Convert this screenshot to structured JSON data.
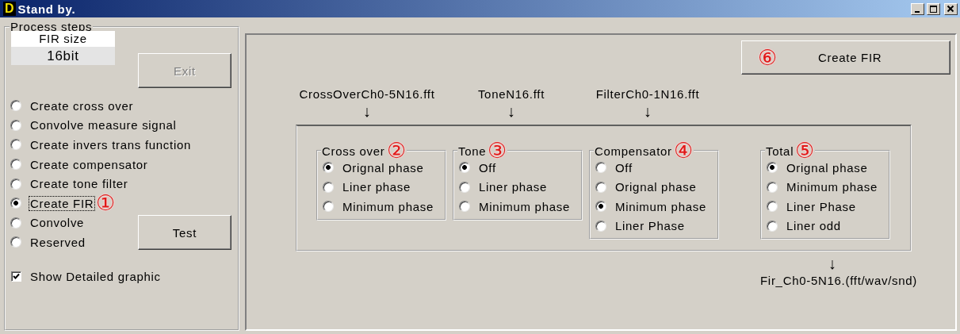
{
  "window": {
    "title": "Stand by.",
    "logo_letter": "D"
  },
  "process_steps": {
    "title": "Process steps",
    "fir_size": {
      "label": "FIR size",
      "value": "16bit"
    },
    "exit_button": {
      "label": "Exit",
      "disabled": true
    },
    "steps": [
      {
        "label": "Create cross over",
        "selected": false
      },
      {
        "label": "Convolve measure signal",
        "selected": false
      },
      {
        "label": "Create invers trans function",
        "selected": false
      },
      {
        "label": "Create compensator",
        "selected": false
      },
      {
        "label": "Create tone filter",
        "selected": false
      },
      {
        "label": "Create FIR",
        "selected": true,
        "marker": "①"
      },
      {
        "label": "Convolve",
        "selected": false
      },
      {
        "label": "Reserved",
        "selected": false
      }
    ],
    "test_button": {
      "label": "Test"
    },
    "show_detailed_graphic": {
      "label": "Show Detailed graphic",
      "checked": true
    }
  },
  "main": {
    "create_button": {
      "label": "Create FIR",
      "marker": "⑥"
    },
    "inputs": [
      {
        "file": "CrossOverCh0-5N16.fft",
        "arrow": "↓"
      },
      {
        "file": "ToneN16.fft",
        "arrow": "↓"
      },
      {
        "file": "FilterCh0-1N16.fft",
        "arrow": "↓"
      }
    ],
    "groups": [
      {
        "title": "Cross over",
        "marker": "②",
        "options": [
          {
            "label": "Orignal phase",
            "selected": true
          },
          {
            "label": "Liner phase",
            "selected": false
          },
          {
            "label": "Minimum phase",
            "selected": false
          }
        ]
      },
      {
        "title": "Tone",
        "marker": "③",
        "options": [
          {
            "label": "Off",
            "selected": true
          },
          {
            "label": "Liner phase",
            "selected": false
          },
          {
            "label": "Minimum phase",
            "selected": false
          }
        ]
      },
      {
        "title": "Compensator",
        "marker": "④",
        "options": [
          {
            "label": "Off",
            "selected": false
          },
          {
            "label": "Orignal phase",
            "selected": false
          },
          {
            "label": "Minimum phase",
            "selected": true
          },
          {
            "label": "Liner Phase",
            "selected": false
          }
        ]
      },
      {
        "title": "Total",
        "marker": "⑤",
        "options": [
          {
            "label": "Orignal phase",
            "selected": true
          },
          {
            "label": "Minimum phase",
            "selected": false
          },
          {
            "label": "Liner Phase",
            "selected": false
          },
          {
            "label": "Liner odd",
            "selected": false
          }
        ]
      }
    ],
    "output": {
      "arrow": "↓",
      "file": "Fir_Ch0-5N16.(fft/wav/snd)"
    }
  }
}
